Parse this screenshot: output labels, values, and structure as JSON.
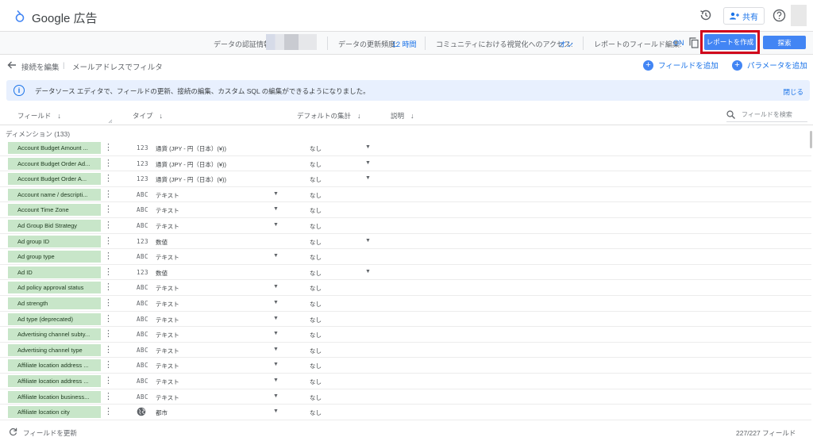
{
  "app": {
    "title": "Google 広告"
  },
  "header": {
    "share_label": "共有"
  },
  "toolbar": {
    "auth_label": "データの認証情報:",
    "refresh_label": "データの更新頻度:",
    "refresh_value": "12 時間",
    "community_label": "コミュニティにおける視覚化へのアクセス:",
    "community_value": "オン",
    "field_edit_label": "レポートのフィールド編集:",
    "field_edit_value": "ON",
    "create_report_label": "レポートを作成",
    "explore_label": "探索"
  },
  "crumbs": {
    "edit_connection": "接続を編集",
    "separator": "|",
    "filter_by_email": "メールアドレスでフィルタ",
    "add_field": "フィールドを追加",
    "add_parameter": "パラメータを追加"
  },
  "banner": {
    "text": "データソース エディタで、フィールドの更新、接続の編集、カスタム SQL の編集ができるようになりました。",
    "close": "閉じる"
  },
  "columns": {
    "field": "フィールド",
    "type": "タイプ",
    "default_agg": "デフォルトの集計",
    "description": "説明",
    "search_placeholder": "フィールドを検索"
  },
  "dimensions": {
    "label": "ディメンション (133)"
  },
  "rows": [
    {
      "name": "Account Budget Amount ...",
      "type_icon": "123",
      "type": "通貨 (JPY - 円（日本）(¥))",
      "agg": "なし",
      "agg_dropdown": true
    },
    {
      "name": "Account Budget Order Ad...",
      "type_icon": "123",
      "type": "通貨 (JPY - 円（日本）(¥))",
      "agg": "なし",
      "agg_dropdown": true
    },
    {
      "name": "Account Budget Order A...",
      "type_icon": "123",
      "type": "通貨 (JPY - 円（日本）(¥))",
      "agg": "なし",
      "agg_dropdown": true
    },
    {
      "name": "Account name / descripti...",
      "type_icon": "ABC",
      "type": "テキスト",
      "agg": "なし",
      "agg_dropdown": false
    },
    {
      "name": "Account Time Zone",
      "type_icon": "ABC",
      "type": "テキスト",
      "agg": "なし",
      "agg_dropdown": false
    },
    {
      "name": "Ad Group Bid Strategy",
      "type_icon": "ABC",
      "type": "テキスト",
      "agg": "なし",
      "agg_dropdown": false
    },
    {
      "name": "Ad group ID",
      "type_icon": "123",
      "type": "数値",
      "agg": "なし",
      "agg_dropdown": true
    },
    {
      "name": "Ad group type",
      "type_icon": "ABC",
      "type": "テキスト",
      "agg": "なし",
      "agg_dropdown": false
    },
    {
      "name": "Ad ID",
      "type_icon": "123",
      "type": "数値",
      "agg": "なし",
      "agg_dropdown": true
    },
    {
      "name": "Ad policy approval status",
      "type_icon": "ABC",
      "type": "テキスト",
      "agg": "なし",
      "agg_dropdown": false
    },
    {
      "name": "Ad strength",
      "type_icon": "ABC",
      "type": "テキスト",
      "agg": "なし",
      "agg_dropdown": false
    },
    {
      "name": "Ad type (deprecated)",
      "type_icon": "ABC",
      "type": "テキスト",
      "agg": "なし",
      "agg_dropdown": false
    },
    {
      "name": "Advertising channel subty...",
      "type_icon": "ABC",
      "type": "テキスト",
      "agg": "なし",
      "agg_dropdown": false
    },
    {
      "name": "Advertising channel type",
      "type_icon": "ABC",
      "type": "テキスト",
      "agg": "なし",
      "agg_dropdown": false
    },
    {
      "name": "Affiliate location address ...",
      "type_icon": "ABC",
      "type": "テキスト",
      "agg": "なし",
      "agg_dropdown": false
    },
    {
      "name": "Affiliate location address ...",
      "type_icon": "ABC",
      "type": "テキスト",
      "agg": "なし",
      "agg_dropdown": false
    },
    {
      "name": "Affiliate location business...",
      "type_icon": "ABC",
      "type": "テキスト",
      "agg": "なし",
      "agg_dropdown": false
    },
    {
      "name": "Affiliate location city",
      "type_icon": "globe",
      "type": "都市",
      "agg": "なし",
      "agg_dropdown": false
    }
  ],
  "footer": {
    "refresh_fields": "フィールドを更新",
    "field_count": "227/227 フィールド"
  },
  "colors": {
    "accent": "#4285f4",
    "chip": "#c8e6c9",
    "highlight": "#d0021b"
  }
}
